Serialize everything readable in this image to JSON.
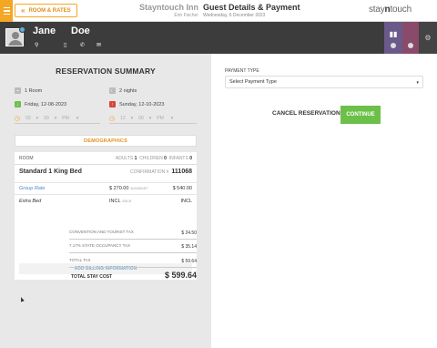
{
  "header": {
    "back_label": "ROOM & RATES",
    "hotel_name": "Stayntouch Inn",
    "user_name": "Erin Fischer",
    "page_title": "Guest Details & Payment",
    "date": "Wednesday, 6 December 2023",
    "logo_part1": "stay",
    "logo_part2": "n",
    "logo_part3": "touch"
  },
  "guest": {
    "first_name": "Jane",
    "last_name": "Doe"
  },
  "summary": {
    "title": "RESERVATION SUMMARY",
    "rooms": "1 Room",
    "nights": "2 nights",
    "arrival": "Friday, 12-08-2023",
    "departure": "Sunday, 12-10-2023",
    "arr_hour": "03",
    "arr_min": "00",
    "arr_ampm": "PM",
    "dep_hour": "12",
    "dep_min": "00",
    "dep_ampm": "PM",
    "demographics_label": "DEMOGRAPHICS"
  },
  "room": {
    "header": "ROOM",
    "adults_label": "ADULTS",
    "adults": "1",
    "children_label": "CHILDREN",
    "children": "0",
    "infants_label": "INFANTS",
    "infants": "0",
    "room_type": "Standard 1 King Bed",
    "confirmation_label": "CONFIRMATION #",
    "confirmation": "111068",
    "rate_name": "Group Rate",
    "rate_price": "$ 270.00",
    "rate_unit": "AVG/NIGHT",
    "rate_total": "$ 540.00",
    "addon_name": "Extra Bed",
    "addon_price": "INCL",
    "addon_unit": "EACH",
    "addon_total": "INCL",
    "billing_label": "ADD BILLING INFORMATION"
  },
  "totals": {
    "tax1_label": "CONVENTION AND TOURIST TAX",
    "tax1": "$ 24.50",
    "tax2_label": "7.17% STATE OCCUPANCY TAX",
    "tax2": "$ 35.14",
    "total_tax_label": "TOTAL TAX",
    "total_tax": "$ 59.64",
    "total_label": "TOTAL STAY COST",
    "total": "$ 599.64"
  },
  "payment": {
    "label": "PAYMENT TYPE",
    "select_value": "Select Payment Type",
    "cancel_label": "CANCEL RESERVATION",
    "continue_label": "CONTINUE"
  },
  "colors": {
    "accent": "#f5a623",
    "continue": "#6cc04a",
    "guest_bar": "#3c3c3c"
  }
}
